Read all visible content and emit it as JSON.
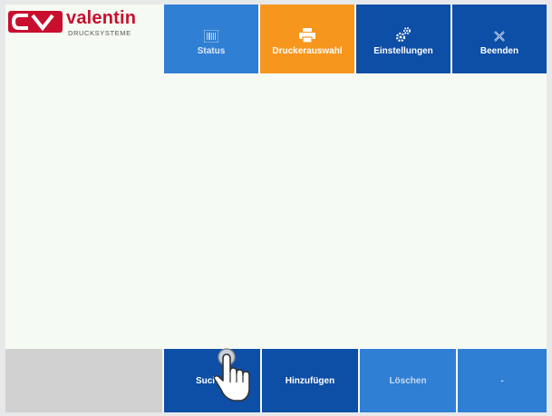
{
  "brand": {
    "logo_mark": "CV",
    "name": "valentin",
    "tagline": "DRUCKSYSTEME"
  },
  "top_nav": [
    {
      "label": "Status",
      "icon": "barcode-icon",
      "state": "light"
    },
    {
      "label": "Druckerauswahl",
      "icon": "printer-icon",
      "state": "active"
    },
    {
      "label": "Einstellungen",
      "icon": "gears-icon",
      "state": "dark"
    },
    {
      "label": "Beenden",
      "icon": "close-icon",
      "state": "dark"
    }
  ],
  "bottom_actions": [
    {
      "label": "Suchen",
      "state": "dark"
    },
    {
      "label": "Hinzufügen",
      "state": "dark"
    },
    {
      "label": "Löschen",
      "state": "disabled"
    },
    {
      "label": "-",
      "state": "disabled"
    }
  ],
  "colors": {
    "brand_red": "#c8102e",
    "active_orange": "#f7961d",
    "dark_blue": "#0d4ea6",
    "light_blue": "#2f7fd4",
    "content_bg": "#f5faf3"
  }
}
